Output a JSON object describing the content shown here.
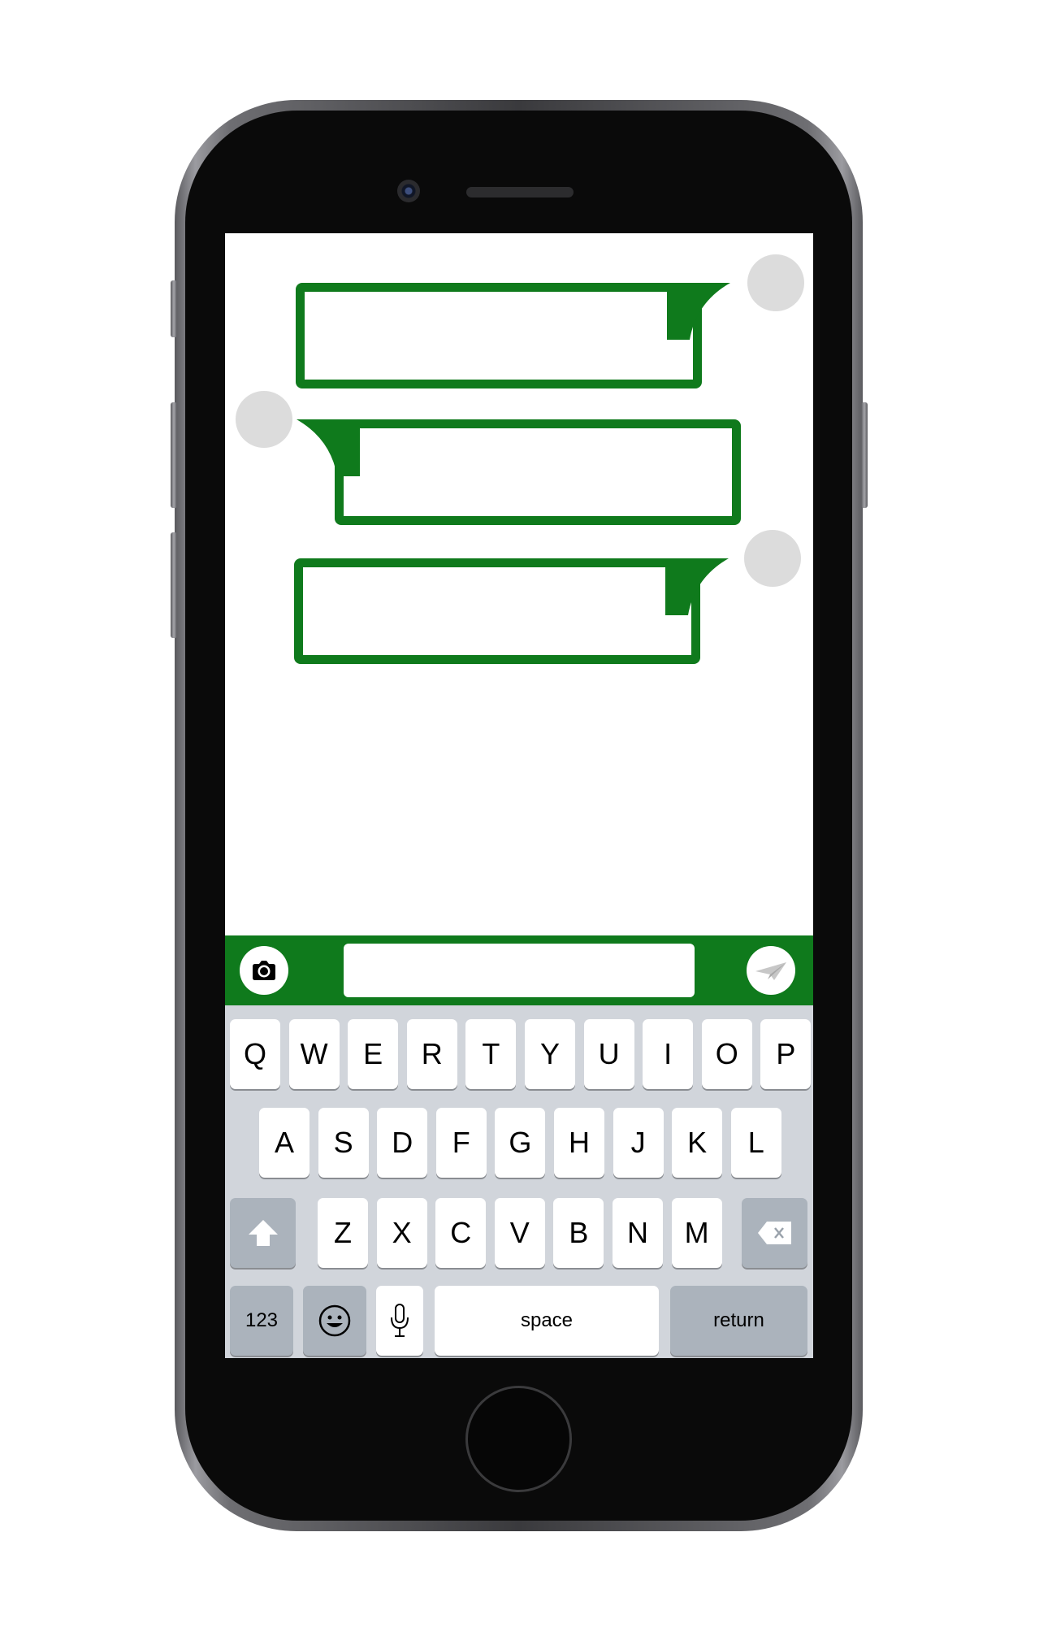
{
  "messages": [
    {
      "side": "outgoing",
      "text": ""
    },
    {
      "side": "incoming",
      "text": ""
    },
    {
      "side": "outgoing",
      "text": ""
    }
  ],
  "composer": {
    "placeholder": "",
    "camera_icon": "camera-icon",
    "send_icon": "paper-plane-icon"
  },
  "keyboard": {
    "row1": [
      "Q",
      "W",
      "E",
      "R",
      "T",
      "Y",
      "U",
      "I",
      "O",
      "P"
    ],
    "row2": [
      "A",
      "S",
      "D",
      "F",
      "G",
      "H",
      "J",
      "K",
      "L"
    ],
    "row3": [
      "Z",
      "X",
      "C",
      "V",
      "B",
      "N",
      "M"
    ],
    "numbers_label": "123",
    "space_label": "space",
    "return_label": "return",
    "shift_icon": "shift-arrow-icon",
    "delete_icon": "backspace-icon",
    "emoji_icon": "smiley-icon",
    "mic_icon": "microphone-icon"
  },
  "colors": {
    "accent": "#0f7a1c",
    "avatar": "#dcdcdc",
    "keyboard_bg": "#d1d5db",
    "key_dark": "#abb3bc"
  }
}
